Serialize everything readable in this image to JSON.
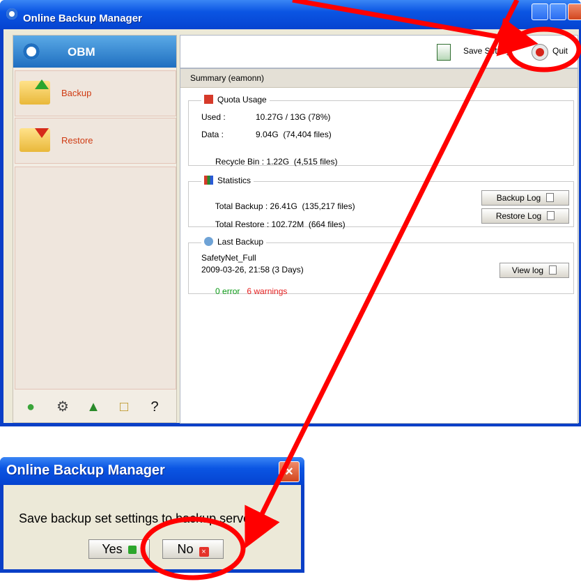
{
  "window": {
    "title": "Online Backup Manager"
  },
  "sidebar": {
    "brand": "OBM",
    "items": [
      {
        "label": "Backup"
      },
      {
        "label": "Restore"
      }
    ],
    "bottom_icons": [
      "user-icon",
      "settings-gear-icon",
      "upload-icon",
      "lock-icon",
      "help-icon"
    ]
  },
  "toolbar": {
    "save_label": "Save Setting",
    "quit_label": "Quit"
  },
  "summary": {
    "title": "Summary (eamonn)",
    "quota": {
      "title": "Quota Usage",
      "rows": [
        {
          "label": "Used :",
          "value": "10.27G / 13G (78%)"
        },
        {
          "label": "Data :",
          "value": "9.04G  (74,404 files)"
        },
        {
          "label": "Recycle Bin :",
          "value": "1.22G  (4,515 files)"
        }
      ]
    },
    "statistics": {
      "title": "Statistics",
      "rows": [
        {
          "label": "Total Backup :",
          "value": "26.41G  (135,217 files)",
          "button": "Backup Log"
        },
        {
          "label": "Total Restore :",
          "value": "102.72M  (664 files)",
          "button": "Restore Log"
        }
      ]
    },
    "last_backup": {
      "title": "Last Backup",
      "set_name": "SafetyNet_Full",
      "datetime": "2009-03-26, 21:58 (3 Days)",
      "errors": "0 error",
      "warnings": "6 warnings",
      "button": "View log"
    }
  },
  "dialog": {
    "title": "Online Backup Manager",
    "message": "Save backup set settings to backup server?",
    "yes_label": "Yes",
    "no_label": "No"
  },
  "colors": {
    "annotation": "#ff0000",
    "titlebar": "#0b55e3"
  }
}
